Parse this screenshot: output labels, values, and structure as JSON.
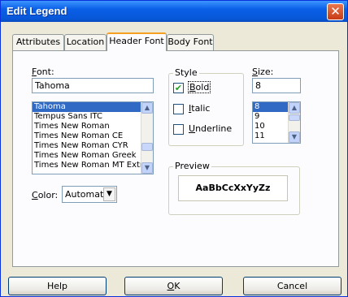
{
  "window": {
    "title": "Edit Legend",
    "close_glyph": "✕"
  },
  "tabs": [
    {
      "label": "Attributes",
      "active": false
    },
    {
      "label": "Location",
      "active": false
    },
    {
      "label": "Header Font",
      "active": true
    },
    {
      "label": "Body Font",
      "active": false
    }
  ],
  "font": {
    "label_hotkey": "F",
    "label_rest": "ont:",
    "value": "Tahoma",
    "items": [
      "Tahoma",
      "Tempus Sans ITC",
      "Times New Roman",
      "Times New Roman CE",
      "Times New Roman CYR",
      "Times New Roman Greek",
      "Times New Roman MT Extra"
    ],
    "selected_index": 0
  },
  "style": {
    "legend": "Style",
    "bold": {
      "hotkey": "B",
      "rest": "old",
      "checked": true
    },
    "italic": {
      "hotkey": "I",
      "rest": "talic",
      "checked": false
    },
    "underline": {
      "hotkey": "U",
      "rest": "nderline",
      "checked": false
    }
  },
  "size": {
    "label_hotkey": "S",
    "label_rest": "ize:",
    "value": "8",
    "items": [
      "8",
      "9",
      "10",
      "11"
    ],
    "selected_index": 0
  },
  "preview": {
    "legend": "Preview",
    "text": "AaBbCcXxYyZz"
  },
  "color": {
    "label_hotkey": "C",
    "label_rest": "olor:",
    "value": "Automatic"
  },
  "buttons": {
    "help": "Help",
    "ok_hotkey": "O",
    "ok_rest": "K",
    "cancel": "Cancel"
  }
}
